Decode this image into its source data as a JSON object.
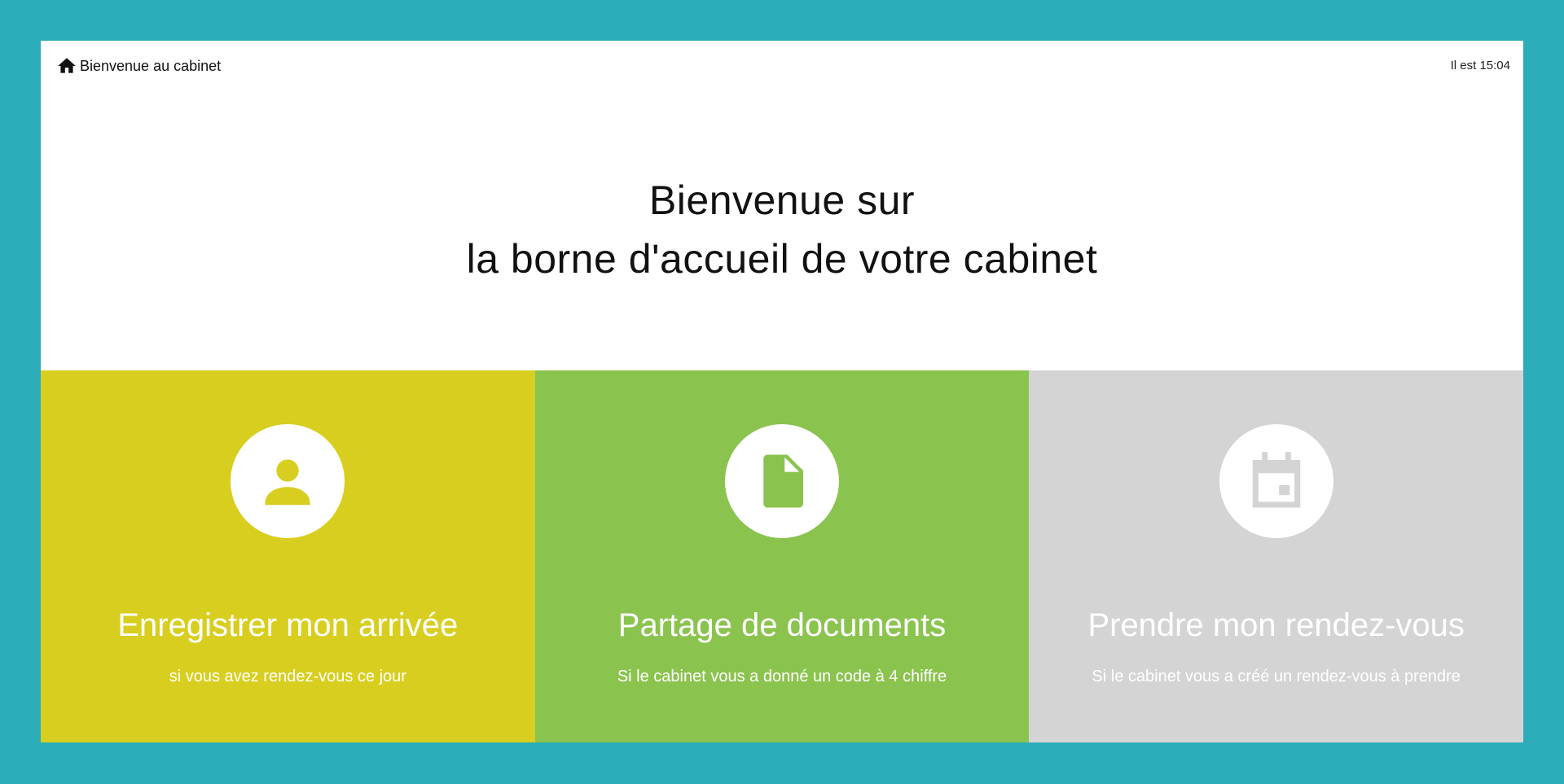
{
  "header": {
    "home_icon": "home-icon",
    "home_label": "Bienvenue au cabinet",
    "clock_text": "Il est 15:04"
  },
  "hero": {
    "line1": "Bienvenue sur",
    "line2": "la borne d'accueil de votre cabinet"
  },
  "colors": {
    "page_background": "#2badb9",
    "panel_background": "#ffffff",
    "checkin": "#d8ce20",
    "documents": "#8bc34f",
    "appointment": "#d4d4d4"
  },
  "cards": [
    {
      "icon": "person-icon",
      "title": "Enregistrer mon arrivée",
      "subtitle": "si vous avez rendez-vous ce jour",
      "color": "#d8ce20"
    },
    {
      "icon": "document-icon",
      "title": "Partage de documents",
      "subtitle": "Si le cabinet vous a donné un code à 4 chiffre",
      "color": "#8bc34f"
    },
    {
      "icon": "calendar-icon",
      "title": "Prendre mon rendez-vous",
      "subtitle": "Si le cabinet vous a créé un rendez-vous à prendre",
      "color": "#d4d4d4"
    }
  ]
}
